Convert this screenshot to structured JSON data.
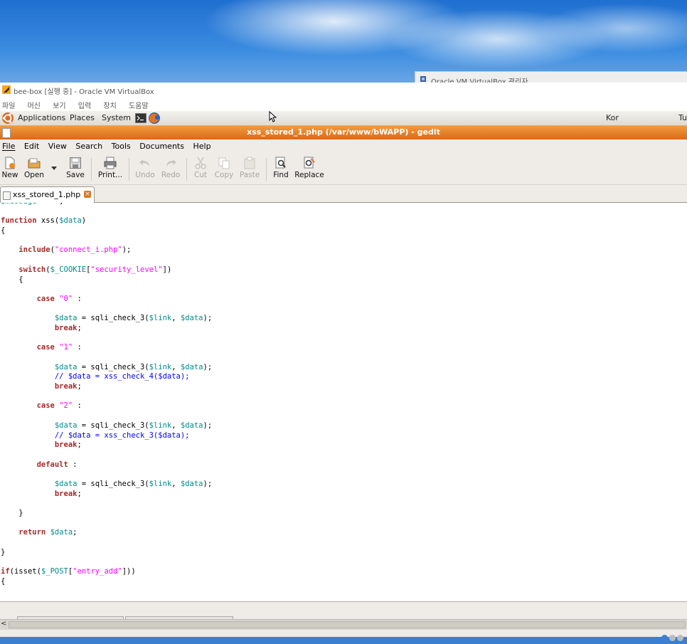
{
  "bg_window": {
    "title": "Oracle VM VirtualBox 관리자"
  },
  "vbox": {
    "title": "bee-box [실행 중] - Oracle VM VirtualBox",
    "menu": [
      "파일",
      "머신",
      "보기",
      "입력",
      "장치",
      "도움말"
    ]
  },
  "gnome_panel": {
    "applications": "Applications",
    "places": "Places",
    "system": "System",
    "keyboard": "Kor",
    "clock": "Tu"
  },
  "gedit": {
    "title": "xss_stored_1.php (/var/www/bWAPP) - gedit",
    "menu": [
      "File",
      "Edit",
      "View",
      "Search",
      "Tools",
      "Documents",
      "Help"
    ],
    "toolbar": {
      "new": "New",
      "open": "Open",
      "save": "Save",
      "print": "Print...",
      "undo": "Undo",
      "redo": "Redo",
      "cut": "Cut",
      "copy": "Copy",
      "paste": "Paste",
      "find": "Find",
      "replace": "Replace"
    },
    "tab": {
      "label": "xss_stored_1.php"
    }
  },
  "colors": {
    "title_bar": "#e07a24",
    "keyword": "#a52a2a",
    "variable": "#008a8c",
    "string": "#ff00ff",
    "comment": "#0000ff"
  },
  "code_lines": [
    [
      [
        "var",
        "$message"
      ],
      [
        "plain",
        " = \"\";"
      ]
    ],
    [],
    [
      [
        "kw",
        "function"
      ],
      [
        "plain",
        " xss("
      ],
      [
        "var",
        "$data"
      ],
      [
        "plain",
        ")"
      ]
    ],
    [
      [
        "plain",
        "{"
      ]
    ],
    [],
    [
      [
        "plain",
        "    "
      ],
      [
        "kw",
        "include"
      ],
      [
        "plain",
        "("
      ],
      [
        "str",
        "\"connect_i.php\""
      ],
      [
        "plain",
        ");"
      ]
    ],
    [],
    [
      [
        "plain",
        "    "
      ],
      [
        "kw",
        "switch"
      ],
      [
        "plain",
        "("
      ],
      [
        "var",
        "$_COOKIE"
      ],
      [
        "plain",
        "["
      ],
      [
        "str",
        "\"security_level\""
      ],
      [
        "plain",
        "])"
      ]
    ],
    [
      [
        "plain",
        "    {"
      ]
    ],
    [],
    [
      [
        "plain",
        "        "
      ],
      [
        "kw",
        "case"
      ],
      [
        "plain",
        " "
      ],
      [
        "str",
        "\"0\""
      ],
      [
        "plain",
        " :"
      ]
    ],
    [],
    [
      [
        "plain",
        "            "
      ],
      [
        "var",
        "$data"
      ],
      [
        "plain",
        " = sqli_check_3("
      ],
      [
        "var",
        "$link"
      ],
      [
        "plain",
        ", "
      ],
      [
        "var",
        "$data"
      ],
      [
        "plain",
        ");"
      ]
    ],
    [
      [
        "plain",
        "            "
      ],
      [
        "kw",
        "break"
      ],
      [
        "plain",
        ";"
      ]
    ],
    [],
    [
      [
        "plain",
        "        "
      ],
      [
        "kw",
        "case"
      ],
      [
        "plain",
        " "
      ],
      [
        "str",
        "\"1\""
      ],
      [
        "plain",
        " :"
      ]
    ],
    [],
    [
      [
        "plain",
        "            "
      ],
      [
        "var",
        "$data"
      ],
      [
        "plain",
        " = sqli_check_3("
      ],
      [
        "var",
        "$link"
      ],
      [
        "plain",
        ", "
      ],
      [
        "var",
        "$data"
      ],
      [
        "plain",
        ");"
      ]
    ],
    [
      [
        "plain",
        "            "
      ],
      [
        "cm",
        "// $data = xss_check_4($data);"
      ]
    ],
    [
      [
        "plain",
        "            "
      ],
      [
        "kw",
        "break"
      ],
      [
        "plain",
        ";"
      ]
    ],
    [],
    [
      [
        "plain",
        "        "
      ],
      [
        "kw",
        "case"
      ],
      [
        "plain",
        " "
      ],
      [
        "str",
        "\"2\""
      ],
      [
        "plain",
        " :"
      ]
    ],
    [],
    [
      [
        "plain",
        "            "
      ],
      [
        "var",
        "$data"
      ],
      [
        "plain",
        " = sqli_check_3("
      ],
      [
        "var",
        "$link"
      ],
      [
        "plain",
        ", "
      ],
      [
        "var",
        "$data"
      ],
      [
        "plain",
        ");"
      ]
    ],
    [
      [
        "plain",
        "            "
      ],
      [
        "cm",
        "// $data = xss_check_3($data);"
      ]
    ],
    [
      [
        "plain",
        "            "
      ],
      [
        "kw",
        "break"
      ],
      [
        "plain",
        ";"
      ]
    ],
    [],
    [
      [
        "plain",
        "        "
      ],
      [
        "kw",
        "default"
      ],
      [
        "plain",
        " :"
      ]
    ],
    [],
    [
      [
        "plain",
        "            "
      ],
      [
        "var",
        "$data"
      ],
      [
        "plain",
        " = sqli_check_3("
      ],
      [
        "var",
        "$link"
      ],
      [
        "plain",
        ", "
      ],
      [
        "var",
        "$data"
      ],
      [
        "plain",
        ");"
      ]
    ],
    [
      [
        "plain",
        "            "
      ],
      [
        "kw",
        "break"
      ],
      [
        "plain",
        ";"
      ]
    ],
    [],
    [
      [
        "plain",
        "    }"
      ]
    ],
    [],
    [
      [
        "plain",
        "    "
      ],
      [
        "kw",
        "return"
      ],
      [
        "plain",
        " "
      ],
      [
        "var",
        "$data"
      ],
      [
        "plain",
        ";"
      ]
    ],
    [],
    [
      [
        "plain",
        "}"
      ]
    ],
    [],
    [
      [
        "kw",
        "if"
      ],
      [
        "plain",
        "(isset("
      ],
      [
        "var",
        "$_POST"
      ],
      [
        "plain",
        "["
      ],
      [
        "str",
        "\"entry_add\""
      ],
      [
        "plain",
        "]))"
      ]
    ],
    [
      [
        "plain",
        "{"
      ]
    ]
  ]
}
